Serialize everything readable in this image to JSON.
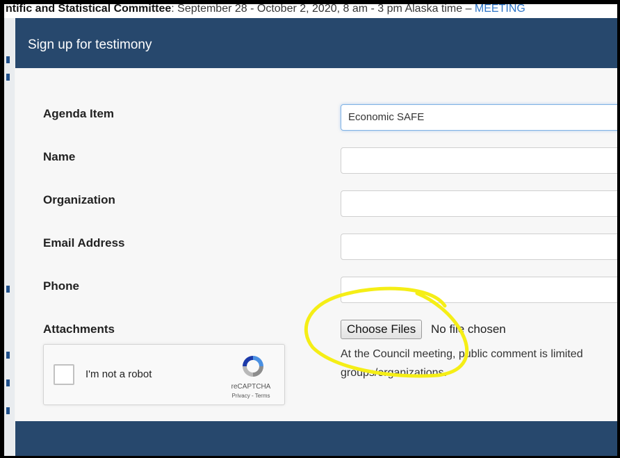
{
  "background": {
    "committee_bold": "ntific and Statistical Committee",
    "committee_rest": ": September 28 - October 2, 2020, 8 am - 3 pm Alaska time – ",
    "meeting_link": "MEETING"
  },
  "modal": {
    "title": "Sign up for testimony"
  },
  "form": {
    "agenda_item": {
      "label": "Agenda Item",
      "value": "Economic SAFE"
    },
    "name": {
      "label": "Name",
      "value": ""
    },
    "organization": {
      "label": "Organization",
      "value": ""
    },
    "email": {
      "label": "Email Address",
      "value": ""
    },
    "phone": {
      "label": "Phone",
      "value": ""
    },
    "attachments": {
      "label": "Attachments",
      "button_label": "Choose Files",
      "status": "No file chosen",
      "help_line1": "At the Council meeting, public comment is limited",
      "help_line2": "groups/organizations."
    }
  },
  "recaptcha": {
    "label": "I'm not a robot",
    "brand": "reCAPTCHA",
    "links": "Privacy - Terms"
  },
  "colors": {
    "header": "#27486d",
    "highlight": "#f5ee16"
  }
}
